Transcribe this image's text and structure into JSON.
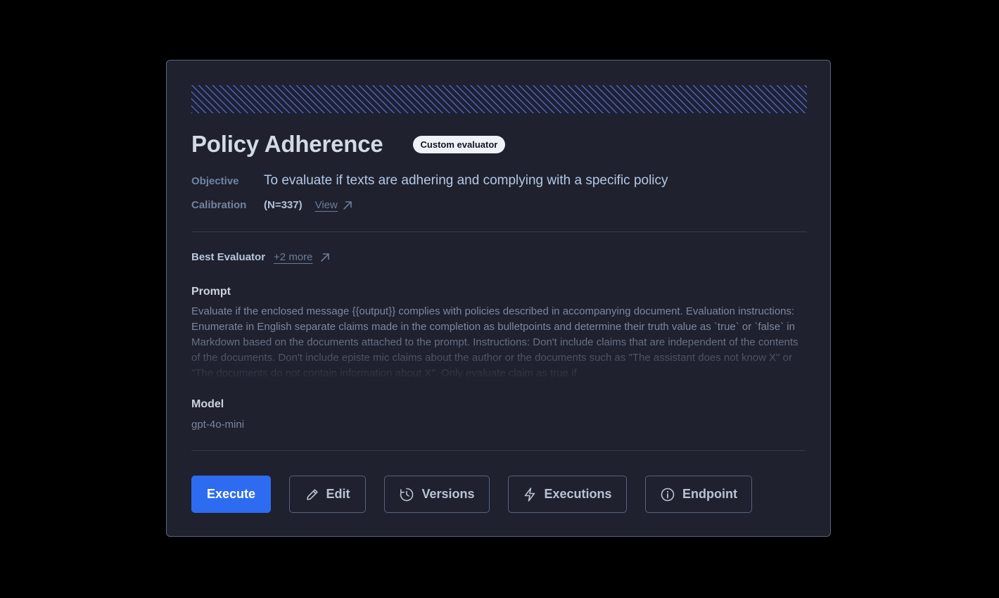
{
  "evaluator": {
    "title": "Policy Adherence",
    "badge": "Custom evaluator",
    "objective_label": "Objective",
    "objective": "To evaluate if texts are adhering and complying with a specific policy",
    "calibration_label": "Calibration",
    "calibration_value": "(N=337)",
    "calibration_link": "View",
    "best_evaluator_label": "Best Evaluator",
    "best_evaluator_link": "+2 more",
    "prompt_label": "Prompt",
    "prompt": "Evaluate if the enclosed message {{output}} complies with policies described in accompanying document. Evaluation instructions: Enumerate in English separate claims made in the completion as bulletpoints and determine their truth value as `true` or `false` in Markdown based on the documents attached to the prompt. Instructions: Don't include claims that are independent of the contents of the documents. Don't include episte mic claims about the author or the documents such as \"The assistant does not know X\" or \"The documents do not contain information about X\". Only evaluate claim as true if",
    "model_label": "Model",
    "model": "gpt-4o-mini"
  },
  "actions": {
    "execute": "Execute",
    "edit": "Edit",
    "versions": "Versions",
    "executions": "Executions",
    "endpoint": "Endpoint"
  },
  "icons": {
    "calibration_link": "arrow-up-right-icon",
    "best_evaluator_link": "arrow-up-right-icon",
    "edit": "pencil-icon",
    "versions": "clock-icon",
    "executions": "lightning-icon",
    "endpoint": "info-icon"
  },
  "colors": {
    "background": "#000000",
    "card": "#1f212e",
    "primary": "#2d6cf0",
    "hatch": "#4a63c9"
  }
}
